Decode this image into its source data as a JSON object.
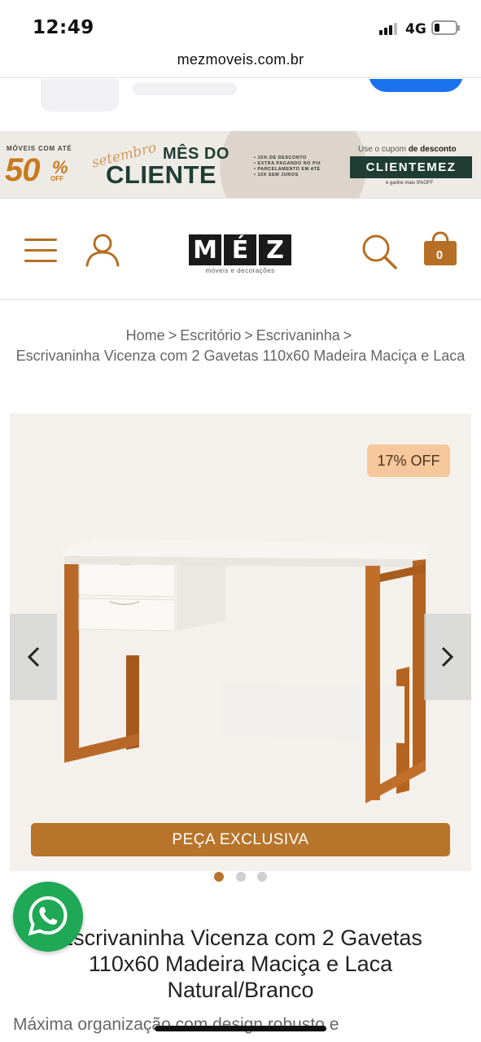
{
  "status_bar": {
    "time": "12:49",
    "network": "4G",
    "battery_level": 0.25
  },
  "browser": {
    "url": "mezmoveis.com.br"
  },
  "promo_banner": {
    "moveis_com_ate": "MÓVEIS COM ATÉ",
    "discount_number": "50",
    "discount_percent": "%",
    "discount_off": "OFF",
    "script_word": "setembro",
    "title_line1": "MÊS DO",
    "title_line2": "CLIENTE",
    "bullets": [
      "15% DE DESCONTO",
      "EXTRA PAGANDO NO PIX",
      "PARCELAMENTO EM ATÉ",
      "10X SEM JUROS"
    ],
    "coupon_intro_prefix": "Use o cupom",
    "coupon_intro_bold": "de desconto",
    "coupon_code": "CLIENTEMEZ",
    "coupon_note": "e ganhe mais 5%OFF",
    "colors": {
      "accent": "#c77a1e",
      "dark_green": "#1f3d33"
    }
  },
  "header": {
    "logo_letters": [
      "M",
      "É",
      "Z"
    ],
    "logo_tagline": "móveis e decorações",
    "cart_count": "0",
    "icons": [
      "menu-icon",
      "user-icon",
      "search-icon",
      "shopping-bag-icon"
    ],
    "brand_color": "#b66f24"
  },
  "breadcrumb": {
    "items": [
      "Home",
      "Escritório",
      "Escrivaninha"
    ],
    "separator": ">",
    "current": "Escrivaninha Vicenza com 2 Gavetas 110x60 Madeira Maciça e Laca"
  },
  "gallery": {
    "discount_badge": "17% OFF",
    "exclusive_label": "PEÇA EXCLUSIVA",
    "slide_count": 3,
    "active_slide": 1,
    "prev_icon": "chevron-left-icon",
    "next_icon": "chevron-right-icon"
  },
  "product": {
    "title": "Escrivaninha Vicenza com 2 Gavetas 110x60 Madeira Maciça e Laca Natural/Branco",
    "description": "Máxima organização com design robusto e"
  },
  "whatsapp": {
    "icon": "whatsapp-icon",
    "color": "#1fa855"
  }
}
